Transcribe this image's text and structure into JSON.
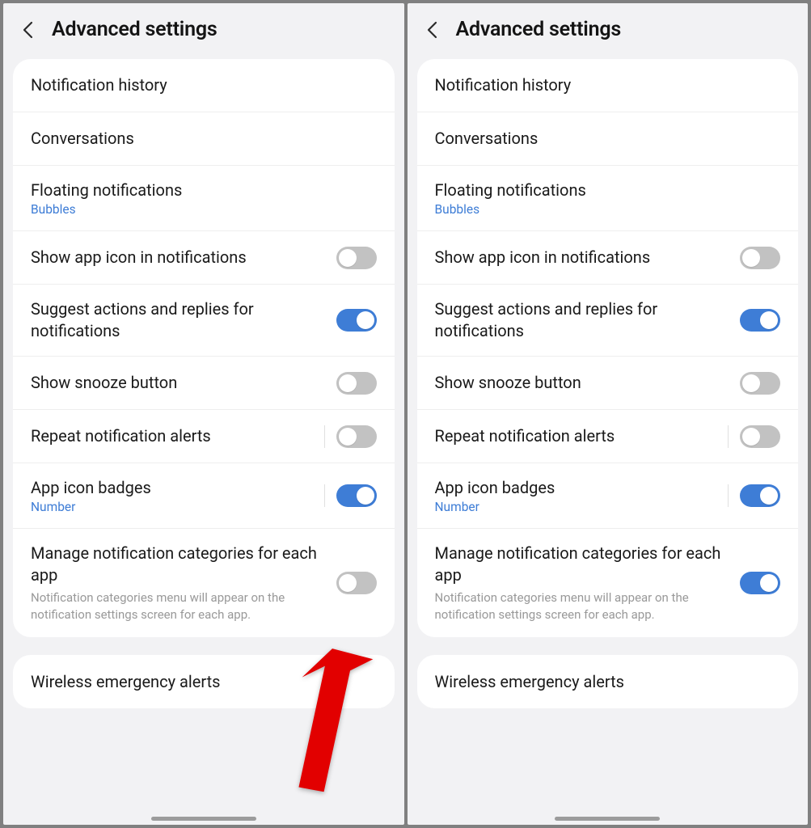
{
  "screens": [
    {
      "title": "Advanced settings",
      "groups": [
        {
          "rows": [
            {
              "label": "Notification history",
              "toggle": null
            },
            {
              "label": "Conversations",
              "toggle": null
            },
            {
              "label": "Floating notifications",
              "sub": "Bubbles",
              "toggle": null
            },
            {
              "label": "Show app icon in notifications",
              "toggle": "off"
            },
            {
              "label": "Suggest actions and replies for notifications",
              "toggle": "on"
            },
            {
              "label": "Show snooze button",
              "toggle": "off"
            },
            {
              "label": "Repeat notification alerts",
              "toggle": "off",
              "divider": true
            },
            {
              "label": "App icon badges",
              "sub": "Number",
              "toggle": "on",
              "divider": true
            },
            {
              "label": "Manage notification categories for each app",
              "desc": "Notification categories menu will appear on the notification settings screen for each app.",
              "toggle": "off"
            }
          ]
        },
        {
          "rows": [
            {
              "label": "Wireless emergency alerts",
              "toggle": null
            }
          ]
        }
      ],
      "arrow": true
    },
    {
      "title": "Advanced settings",
      "groups": [
        {
          "rows": [
            {
              "label": "Notification history",
              "toggle": null
            },
            {
              "label": "Conversations",
              "toggle": null
            },
            {
              "label": "Floating notifications",
              "sub": "Bubbles",
              "toggle": null
            },
            {
              "label": "Show app icon in notifications",
              "toggle": "off"
            },
            {
              "label": "Suggest actions and replies for notifications",
              "toggle": "on"
            },
            {
              "label": "Show snooze button",
              "toggle": "off"
            },
            {
              "label": "Repeat notification alerts",
              "toggle": "off",
              "divider": true
            },
            {
              "label": "App icon badges",
              "sub": "Number",
              "toggle": "on",
              "divider": true
            },
            {
              "label": "Manage notification categories for each app",
              "desc": "Notification categories menu will appear on the notification settings screen for each app.",
              "toggle": "on"
            }
          ]
        },
        {
          "rows": [
            {
              "label": "Wireless emergency alerts",
              "toggle": null
            }
          ]
        }
      ],
      "arrow": false
    }
  ]
}
